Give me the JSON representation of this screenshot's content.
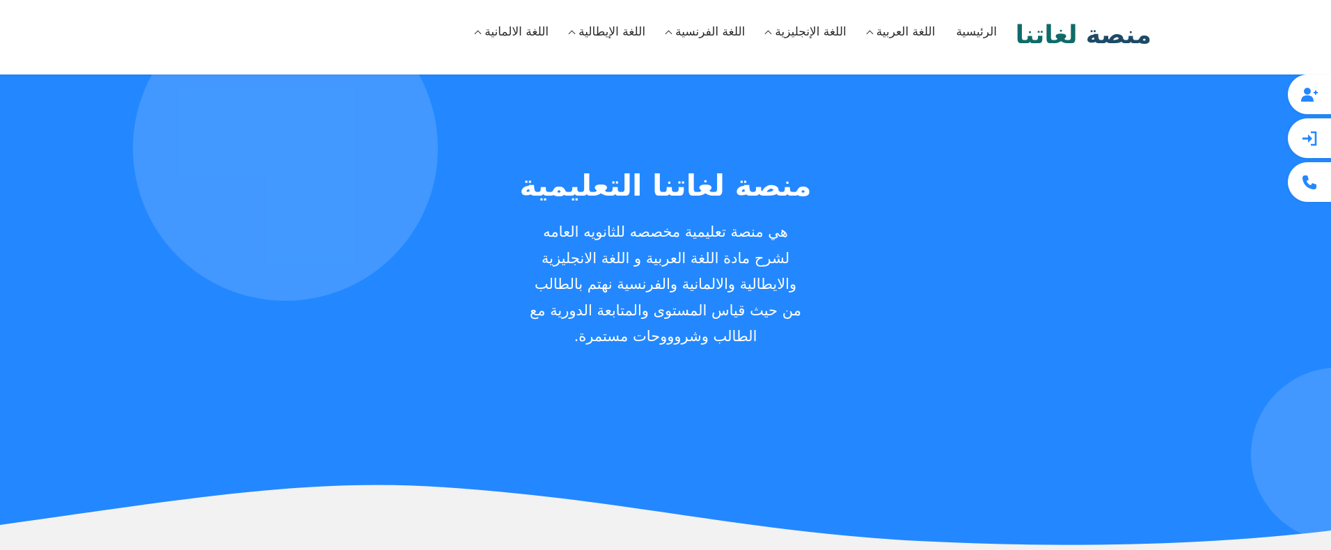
{
  "header": {
    "logo_word1": "منصة",
    "logo_word2": "لغاتنا"
  },
  "nav": {
    "items": [
      {
        "label": "الرئيسية"
      },
      {
        "label": "اللغة العربية"
      },
      {
        "label": "اللغة الإنجليزية"
      },
      {
        "label": "اللغة الفرنسية"
      },
      {
        "label": "اللغة الإيطالية"
      },
      {
        "label": "اللغة الالمانية"
      }
    ]
  },
  "hero": {
    "title": "منصة لغاتنا التعليمية",
    "description_lines": [
      "هي منصة تعليمية مخصصه للثانويه العامه",
      "لشرح مادة اللغة العربية و اللغة الانجليزية",
      "والايطالية والالمانية والفرنسية نهتم بالطالب",
      "من حيث قياس المستوى والمتابعة الدورية مع",
      "الطالب وشروووحات مستمرة."
    ]
  },
  "side_buttons": {
    "icons": [
      "user-plus-icon",
      "sign-in-icon",
      "phone-icon"
    ]
  },
  "colors": {
    "hero_blue": "#2388ff",
    "logo_dark": "#1d4a66",
    "logo_teal": "#0f6b6a",
    "page_bg": "#f2f2f2"
  }
}
